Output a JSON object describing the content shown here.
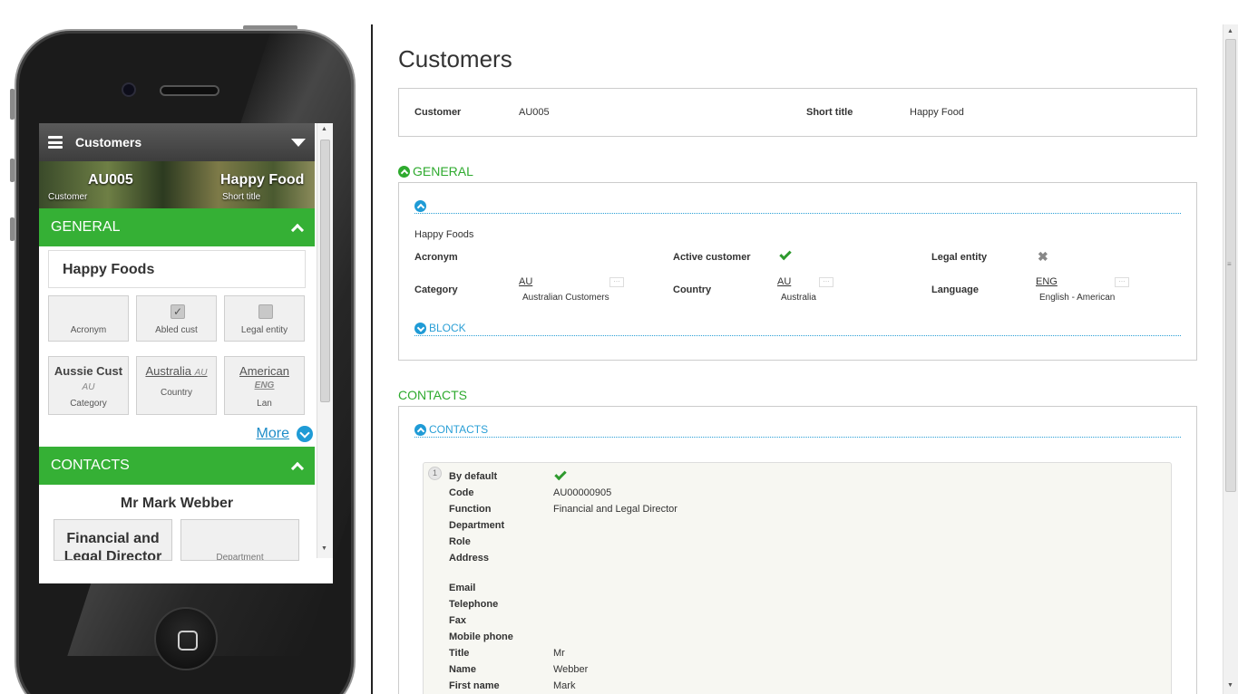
{
  "mobile": {
    "header": {
      "title": "Customers"
    },
    "hero": {
      "code": "AU005",
      "code_caption": "Customer",
      "name": "Happy Food",
      "name_caption": "Short title"
    },
    "general": {
      "title": "GENERAL",
      "name": "Happy Foods",
      "tiles": [
        {
          "caption": "Acronym"
        },
        {
          "caption": "Abled cust",
          "checked": true
        },
        {
          "caption": "Legal entity",
          "checked": false
        }
      ],
      "category": {
        "value": "Aussie Cust",
        "code": "AU",
        "caption": "Category"
      },
      "country": {
        "value": "Australia",
        "code": "AU",
        "caption": "Country"
      },
      "language": {
        "value": "American",
        "code": "ENG",
        "caption": "Lan"
      },
      "more": "More"
    },
    "contacts": {
      "title": "CONTACTS",
      "name": "Mr Mark Webber",
      "tile1": "Financial and Legal Director",
      "tile2": "Department"
    }
  },
  "page": {
    "title": "Customers",
    "header": {
      "customer_label": "Customer",
      "customer_value": "AU005",
      "short_title_label": "Short title",
      "short_title_value": "Happy Food"
    },
    "general": {
      "title": "GENERAL",
      "company_name": "Happy Foods",
      "acronym_label": "Acronym",
      "active_customer_label": "Active customer",
      "active_customer": true,
      "legal_entity_label": "Legal entity",
      "legal_entity": false,
      "category_label": "Category",
      "category_code": "AU",
      "category_desc": "Australian Customers",
      "country_label": "Country",
      "country_code": "AU",
      "country_desc": "Australia",
      "language_label": "Language",
      "language_code": "ENG",
      "language_desc": "English - American",
      "block_label": "BLOCK"
    },
    "contacts": {
      "title": "CONTACTS",
      "subtitle": "CONTACTS",
      "index": "1",
      "fields": [
        {
          "label": "By default",
          "value": "",
          "check": true
        },
        {
          "label": "Code",
          "value": "AU00000905"
        },
        {
          "label": "Function",
          "value": "Financial and Legal Director"
        },
        {
          "label": "Department",
          "value": ""
        },
        {
          "label": "Role",
          "value": ""
        },
        {
          "label": "Address",
          "value": ""
        },
        {
          "label": "Email",
          "value": ""
        },
        {
          "label": "Telephone",
          "value": ""
        },
        {
          "label": "Fax",
          "value": ""
        },
        {
          "label": "Mobile phone",
          "value": ""
        },
        {
          "label": "Title",
          "value": "Mr"
        },
        {
          "label": "Name",
          "value": "Webber"
        },
        {
          "label": "First name",
          "value": "Mark"
        }
      ]
    }
  },
  "colors": {
    "green": "#35b035",
    "blue": "#1f9bd6",
    "section_text": "#2eaa2e"
  }
}
